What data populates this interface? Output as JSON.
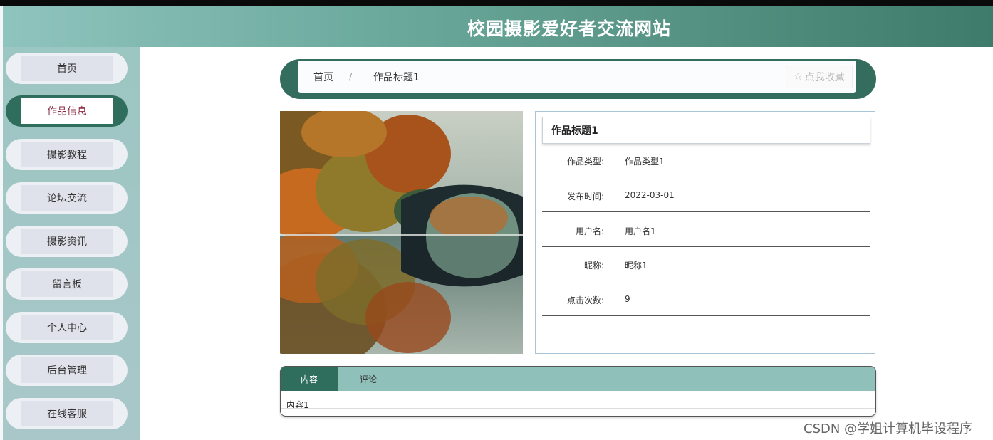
{
  "header": {
    "title": "校园摄影爱好者交流网站"
  },
  "sidebar": {
    "items": [
      {
        "label": "首页"
      },
      {
        "label": "作品信息"
      },
      {
        "label": "摄影教程"
      },
      {
        "label": "论坛交流"
      },
      {
        "label": "摄影资讯"
      },
      {
        "label": "留言板"
      },
      {
        "label": "个人中心"
      },
      {
        "label": "后台管理"
      },
      {
        "label": "在线客服"
      }
    ],
    "active_index": 1
  },
  "breadcrumb": {
    "home": "首页",
    "separator": "/",
    "current": "作品标题1"
  },
  "favorite_button": {
    "icon": "star-outline-icon",
    "label": "点我收藏"
  },
  "detail": {
    "title": "作品标题1",
    "fields": [
      {
        "label": "作品类型:",
        "value": "作品类型1"
      },
      {
        "label": "发布时间:",
        "value": "2022-03-01"
      },
      {
        "label": "用户名:",
        "value": "用户名1"
      },
      {
        "label": "昵称:",
        "value": "昵称1"
      },
      {
        "label": "点击次数:",
        "value": "9"
      }
    ]
  },
  "tabs": {
    "items": [
      {
        "label": "内容"
      },
      {
        "label": "评论"
      }
    ],
    "active_index": 0,
    "content": "内容1"
  },
  "watermark": "CSDN @学姐计算机毕设程序",
  "colors": {
    "accent": "#2f6e5d",
    "header_start": "#8fc4be",
    "header_end": "#3f7b6a",
    "active_text": "#8a2b44"
  }
}
